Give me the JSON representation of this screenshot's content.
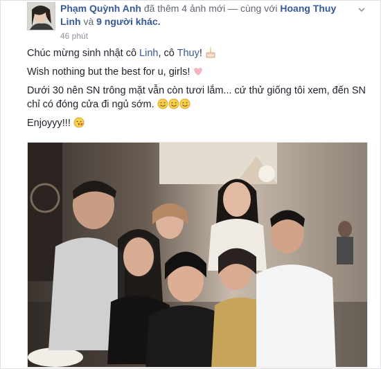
{
  "post": {
    "author": "Phạm Quỳnh Anh",
    "action": "đã thêm 4 ảnh mới — cùng với",
    "tagged_first": "Hoang Thuy Linh",
    "connector": "và",
    "tagged_others": "9 người khác.",
    "time": "46 phút",
    "lines": {
      "l1_a": "Chúc mừng sinh nhật cô ",
      "l1_link1": "Linh",
      "l1_b": ", cô ",
      "l1_link2": "Thuy",
      "l1_c": "!",
      "l2": "Wish nothing but the best for u, girls!",
      "l3": "Dưới 30 nên SN trông mặt vẫn còn tươi lắm... cứ thử giống tôi xem, đến SN chỉ có đóng cửa đi ngủ sớm.",
      "l4": "Enjoyyy!!!"
    }
  },
  "icons": [
    "chevron-down-icon",
    "birthday-cake-icon",
    "heart-icon",
    "smile-icon",
    "kiss-icon"
  ],
  "colors": {
    "link": "#365899",
    "text": "#1d2129",
    "meta": "#90949c"
  }
}
